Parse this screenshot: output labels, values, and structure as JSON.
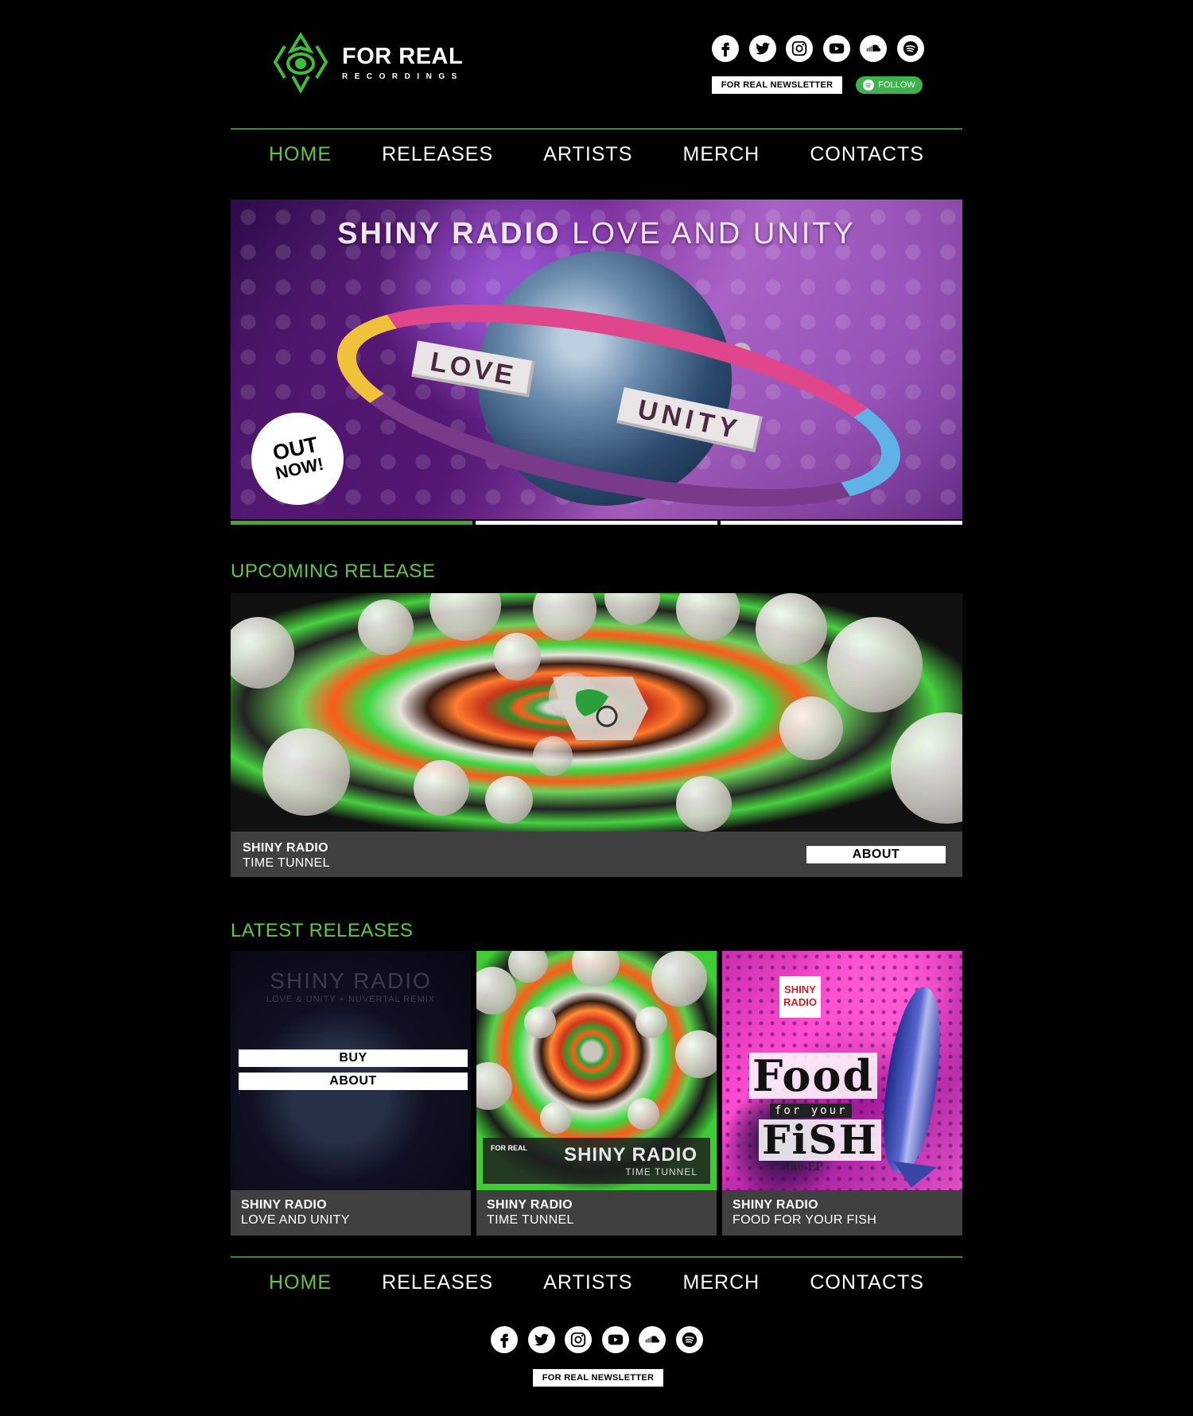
{
  "brand": {
    "title": "FOR REAL",
    "subtitle": "RECORDINGS",
    "color_accent": "#62c843"
  },
  "social": {
    "icons": [
      "facebook-icon",
      "twitter-icon",
      "instagram-icon",
      "youtube-icon",
      "soundcloud-icon",
      "spotify-icon"
    ]
  },
  "header": {
    "newsletter_label": "FOR REAL NEWSLETTER",
    "follow_label": "FOLLOW"
  },
  "nav": {
    "items": [
      "HOME",
      "RELEASES",
      "ARTISTS",
      "MERCH",
      "CONTACTS"
    ],
    "active": "HOME"
  },
  "hero": {
    "title_artist": "SHINY RADIO",
    "title_release": "LOVE AND UNITY",
    "beads_left": "LOVE",
    "beads_right": "UNITY",
    "out_now_line1": "OUT",
    "out_now_line2": "NOW!",
    "slides_count": 3,
    "active_slide": 1
  },
  "upcoming": {
    "heading": "UPCOMING RELEASE",
    "artist": "SHINY RADIO",
    "title": "TIME TUNNEL",
    "about_label": "ABOUT"
  },
  "latest": {
    "heading": "LATEST RELEASES",
    "releases": [
      {
        "artist": "SHINY RADIO",
        "title": "LOVE AND UNITY",
        "cover_title": "SHINY RADIO",
        "cover_sub": "LOVE & UNITY + NUVERTAL REMIX",
        "buy_label": "BUY",
        "about_label": "ABOUT"
      },
      {
        "artist": "SHINY RADIO",
        "title": "TIME TUNNEL",
        "cover_artist": "SHINY RADIO",
        "cover_title": "TIME TUNNEL",
        "cover_logo": "FOR REAL"
      },
      {
        "artist": "SHINY RADIO",
        "title": "FOOD FOR YOUR FISH",
        "cover_badge": "SHINY RADIO",
        "cover_food": "Food",
        "cover_foryour": "for your",
        "cover_fish": "FiSH",
        "cover_ep": "the EP"
      }
    ]
  },
  "footer": {
    "newsletter_label": "FOR REAL NEWSLETTER"
  }
}
